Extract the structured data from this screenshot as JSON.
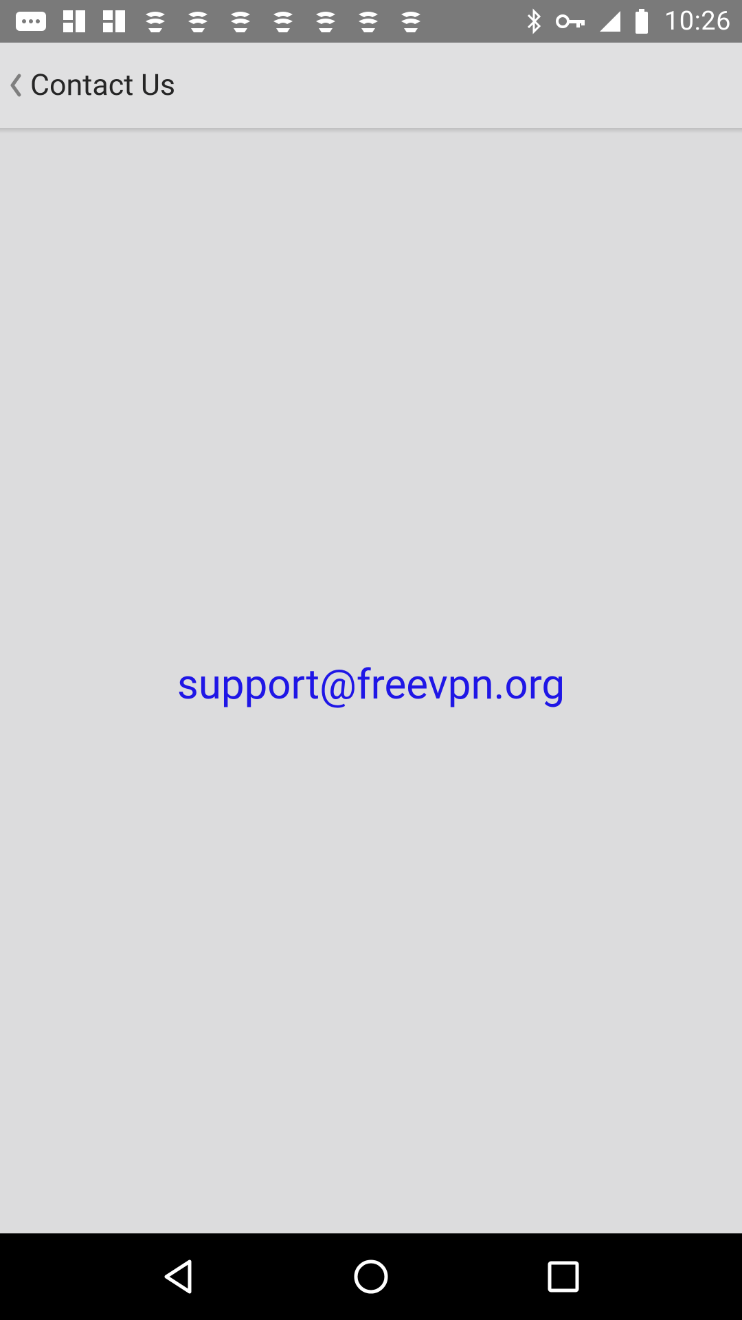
{
  "status_bar": {
    "time": "10:26",
    "left_icons": [
      "more-icon",
      "photos-icon",
      "photos-icon",
      "sync-icon",
      "sync-icon",
      "sync-icon",
      "sync-icon",
      "sync-icon",
      "sync-icon",
      "sync-icon"
    ],
    "right_icons": [
      "bluetooth-icon",
      "vpn-key-icon",
      "signal-icon",
      "battery-icon"
    ]
  },
  "app_bar": {
    "title": "Contact Us"
  },
  "content": {
    "email": "support@freevpn.org"
  },
  "colors": {
    "status_bar_bg": "#7a7a7a",
    "app_bar_bg": "#e0e0e1",
    "page_bg": "#dcdcdd",
    "link": "#1f16e6",
    "nav_bar_bg": "#000000"
  }
}
